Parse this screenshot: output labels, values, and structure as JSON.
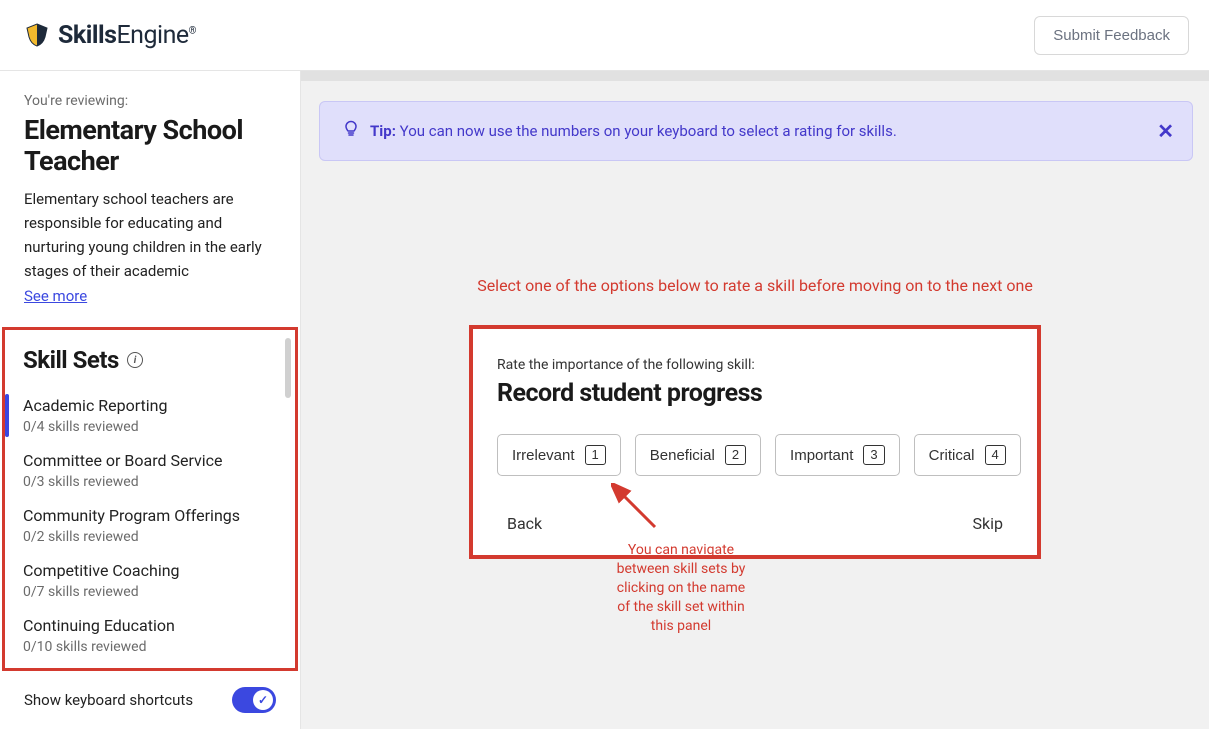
{
  "brand": {
    "strong": "Skills",
    "light": "Engine"
  },
  "header": {
    "feedback_label": "Submit Feedback"
  },
  "sidebar": {
    "review_label": "You're reviewing:",
    "job_title": "Elementary School Teacher",
    "job_desc": "Elementary school teachers are responsible for educating and nurturing young children in the early stages of their academic",
    "see_more": "See more",
    "section_title": "Skill Sets",
    "items": [
      {
        "name": "Academic Reporting",
        "progress": "0/4 skills reviewed",
        "active": true
      },
      {
        "name": "Committee or Board Service",
        "progress": "0/3 skills reviewed",
        "active": false
      },
      {
        "name": "Community Program Offerings",
        "progress": "0/2 skills reviewed",
        "active": false
      },
      {
        "name": "Competitive Coaching",
        "progress": "0/7 skills reviewed",
        "active": false
      },
      {
        "name": "Continuing Education",
        "progress": "0/10 skills reviewed",
        "active": false
      }
    ],
    "shortcut_label": "Show keyboard shortcuts"
  },
  "tip": {
    "label": "Tip:",
    "text": "You can now use the numbers on your keyboard to select a rating for skills."
  },
  "error_prompt": "Select one of the options below  to rate a skill before moving on to the next one",
  "rating": {
    "prompt": "Rate the importance of the following skill:",
    "skill": "Record student progress",
    "options": [
      {
        "label": "Irrelevant",
        "key": "1"
      },
      {
        "label": "Beneficial",
        "key": "2"
      },
      {
        "label": "Important",
        "key": "3"
      },
      {
        "label": "Critical",
        "key": "4"
      }
    ],
    "back": "Back",
    "skip": "Skip"
  },
  "annotation": "You can navigate between skill sets by clicking on the name of the skill set within this panel"
}
